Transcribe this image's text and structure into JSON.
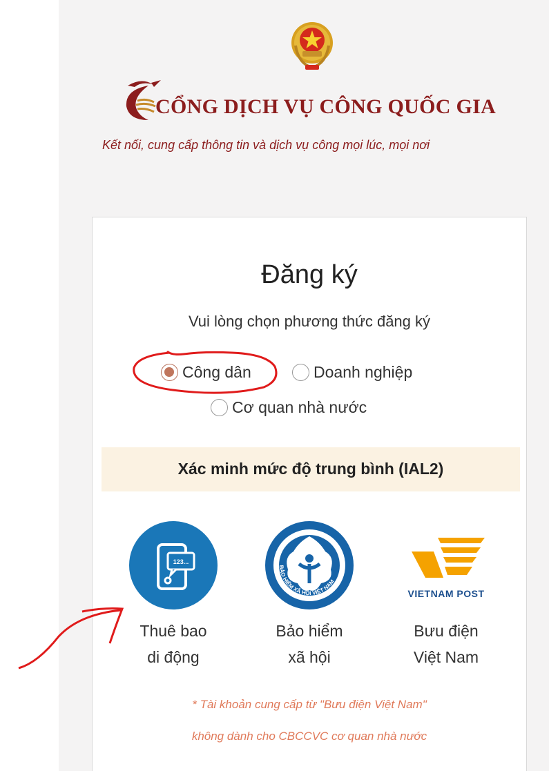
{
  "header": {
    "title": "CỔNG DỊCH VỤ CÔNG QUỐC GIA",
    "tagline": "Kết nối, cung cấp thông tin và dịch vụ công mọi lúc, mọi nơi",
    "emblem_icon": "national-emblem-icon",
    "logo_icon": "crane-bird-logo-icon"
  },
  "registration": {
    "title": "Đăng ký",
    "subtitle": "Vui lòng chọn phương thức đăng ký",
    "options": [
      {
        "label": "Công dân",
        "selected": true
      },
      {
        "label": "Doanh nghiệp",
        "selected": false
      },
      {
        "label": "Cơ quan nhà nước",
        "selected": false
      }
    ],
    "verification_level": "Xác minh mức độ trung bình (IAL2)",
    "methods": [
      {
        "line1": "Thuê bao",
        "line2": "di động",
        "icon": "mobile-subscriber-icon",
        "icon_text": "123..."
      },
      {
        "line1": "Bảo hiểm",
        "line2": "xã hội",
        "icon": "social-insurance-icon",
        "icon_text": "BẢO HIỂM XÃ HỘI VIỆT NAM"
      },
      {
        "line1": "Bưu điện",
        "line2": "Việt Nam",
        "icon": "vietnam-post-icon",
        "icon_text": "VIETNAM POST"
      }
    ],
    "note_line1": "* Tài khoản cung cấp từ \"Bưu điện Việt Nam\"",
    "note_line2": "không dành cho CBCCVC cơ quan nhà nước"
  },
  "colors": {
    "brand_red": "#8c1d1d",
    "radio_selected": "#c0765d",
    "banner_bg": "#fbf2e2",
    "note_orange": "#e07a5a",
    "annotation_red": "#e01b1b",
    "mobile_icon_blue": "#1a77b8",
    "post_gold": "#f5a200"
  }
}
